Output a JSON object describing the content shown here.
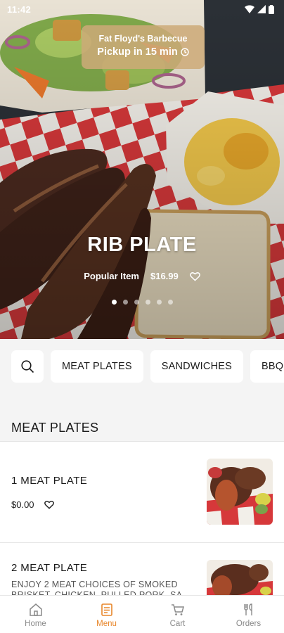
{
  "status": {
    "time": "11:42"
  },
  "pickup": {
    "restaurant": "Fat Floyd's Barbecue",
    "eta": "Pickup in 15 min"
  },
  "hero": {
    "title": "RIB PLATE",
    "tag": "Popular Item",
    "price": "$16.99",
    "slides": 6,
    "active_slide": 0
  },
  "categories": [
    "MEAT PLATES",
    "SANDWICHES",
    "BBQ"
  ],
  "section": {
    "title": "MEAT PLATES"
  },
  "items": [
    {
      "name": "1 MEAT PLATE",
      "price": "$0.00"
    },
    {
      "name": "2 MEAT PLATE",
      "description": "ENJOY 2 MEAT CHOICES OF SMOKED BRISKET, CHICKEN, PULLED PORK, SA"
    }
  ],
  "nav": [
    {
      "label": "Home",
      "icon": "home-icon",
      "active": false
    },
    {
      "label": "Menu",
      "icon": "menu-icon",
      "active": true
    },
    {
      "label": "Cart",
      "icon": "cart-icon",
      "active": false
    },
    {
      "label": "Orders",
      "icon": "orders-icon",
      "active": false
    }
  ],
  "colors": {
    "accent": "#e8862a",
    "pickup_card": "#cdaa78",
    "background": "#f4f4f4"
  }
}
